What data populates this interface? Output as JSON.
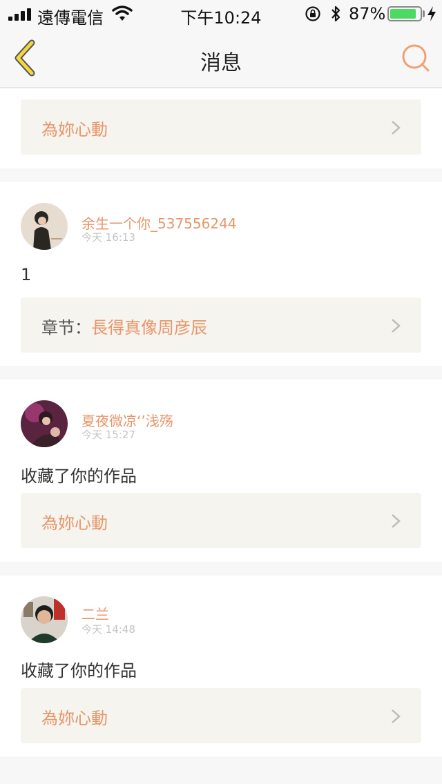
{
  "status_bar": {
    "carrier": "遠傳電信",
    "time": "下午10:24",
    "battery_percent": "87%",
    "battery_level": 0.87
  },
  "nav": {
    "title": "消息"
  },
  "top_card": {
    "link_label": "為妳心動"
  },
  "messages": [
    {
      "user_name": "余生一个你_537556244",
      "timestamp": "今天 16:13",
      "text": "1",
      "link_prefix": "章节：",
      "link_label": "長得真像周彦辰"
    },
    {
      "user_name": "夏夜微凉‘’浅殇",
      "timestamp": "今天 15:27",
      "text": "收藏了你的作品",
      "link_label": "為妳心動"
    },
    {
      "user_name": "二兰",
      "timestamp": "今天 14:48",
      "text": "收藏了你的作品",
      "link_label": "為妳心動"
    }
  ],
  "colors": {
    "accent": "#e8966a",
    "back_arrow": "#f5d63c",
    "link_box_bg": "#f5f4ee",
    "battery": "#4cd964"
  }
}
